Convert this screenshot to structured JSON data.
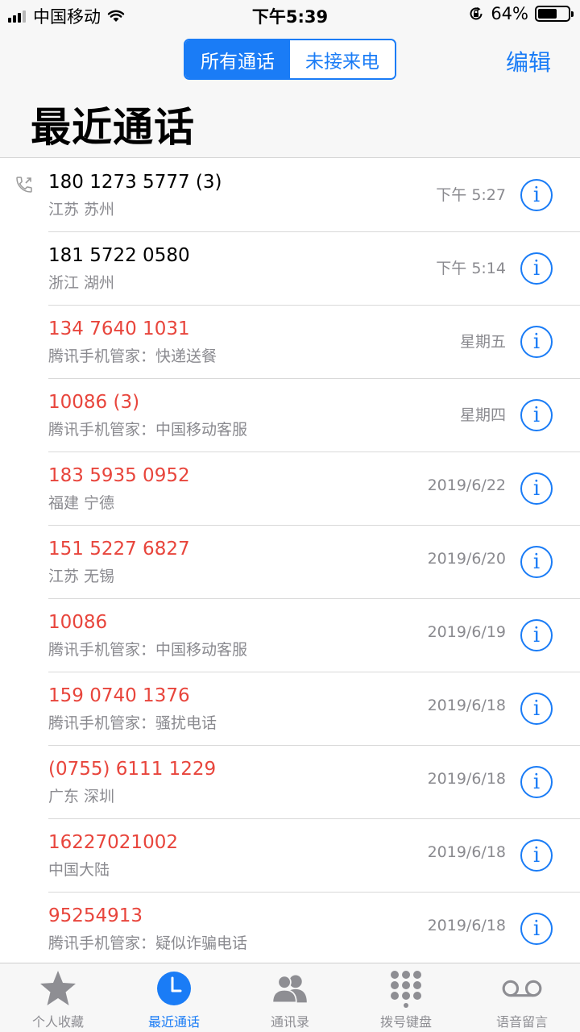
{
  "status_bar": {
    "carrier": "中国移动",
    "time": "下午5:39",
    "battery": "64%",
    "battery_level": 0.64
  },
  "header": {
    "segments": [
      {
        "label": "所有通话",
        "active": true
      },
      {
        "label": "未接来电",
        "active": false
      }
    ],
    "edit_label": "编辑",
    "title": "最近通话"
  },
  "calls": [
    {
      "number": "180 1273 5777 (3)",
      "location": "江苏 苏州",
      "time": "下午 5:27",
      "missed": false,
      "outgoing": true
    },
    {
      "number": "181 5722 0580",
      "location": "浙江 湖州",
      "time": "下午 5:14",
      "missed": false,
      "outgoing": false
    },
    {
      "number": "134 7640 1031",
      "location": "腾讯手机管家：快递送餐",
      "time": "星期五",
      "missed": true,
      "outgoing": false
    },
    {
      "number": "10086 (3)",
      "location": "腾讯手机管家：中国移动客服",
      "time": "星期四",
      "missed": true,
      "outgoing": false
    },
    {
      "number": "183 5935 0952",
      "location": "福建 宁德",
      "time": "2019/6/22",
      "missed": true,
      "outgoing": false
    },
    {
      "number": "151 5227 6827",
      "location": "江苏 无锡",
      "time": "2019/6/20",
      "missed": true,
      "outgoing": false
    },
    {
      "number": "10086",
      "location": "腾讯手机管家：中国移动客服",
      "time": "2019/6/19",
      "missed": true,
      "outgoing": false
    },
    {
      "number": "159 0740 1376",
      "location": "腾讯手机管家：骚扰电话",
      "time": "2019/6/18",
      "missed": true,
      "outgoing": false
    },
    {
      "number": "(0755) 6111 1229",
      "location": "广东 深圳",
      "time": "2019/6/18",
      "missed": true,
      "outgoing": false
    },
    {
      "number": "16227021002",
      "location": "中国大陆",
      "time": "2019/6/18",
      "missed": true,
      "outgoing": false
    },
    {
      "number": "95254913",
      "location": "腾讯手机管家：疑似诈骗电话",
      "time": "2019/6/18",
      "missed": true,
      "outgoing": false
    }
  ],
  "info_glyph": "i",
  "tabs": [
    {
      "label": "个人收藏",
      "icon": "star-icon",
      "active": false
    },
    {
      "label": "最近通话",
      "icon": "clock-icon",
      "active": true
    },
    {
      "label": "通讯录",
      "icon": "contacts-icon",
      "active": false
    },
    {
      "label": "拨号键盘",
      "icon": "keypad-icon",
      "active": false
    },
    {
      "label": "语音留言",
      "icon": "voicemail-icon",
      "active": false
    }
  ],
  "colors": {
    "accent": "#1a7cf6",
    "missed": "#e8453c",
    "secondary_text": "#8a8a8f",
    "tab_inactive": "#8e8e93"
  }
}
